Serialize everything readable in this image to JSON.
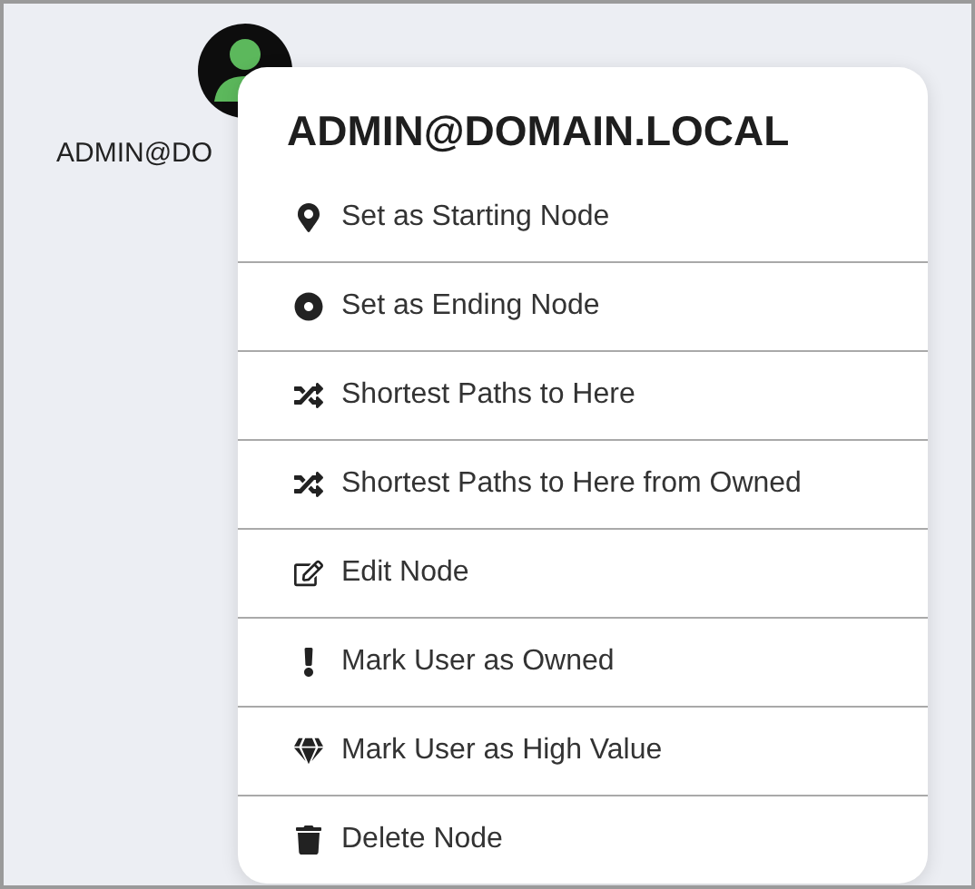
{
  "node": {
    "label": "ADMIN@DO"
  },
  "context_menu": {
    "title": "ADMIN@DOMAIN.LOCAL",
    "items": [
      {
        "label": "Set as Starting Node"
      },
      {
        "label": "Set as Ending Node"
      },
      {
        "label": "Shortest Paths to Here"
      },
      {
        "label": "Shortest Paths to Here from Owned"
      },
      {
        "label": "Edit Node"
      },
      {
        "label": "Mark User as Owned"
      },
      {
        "label": "Mark User as High Value"
      },
      {
        "label": "Delete Node"
      }
    ]
  }
}
